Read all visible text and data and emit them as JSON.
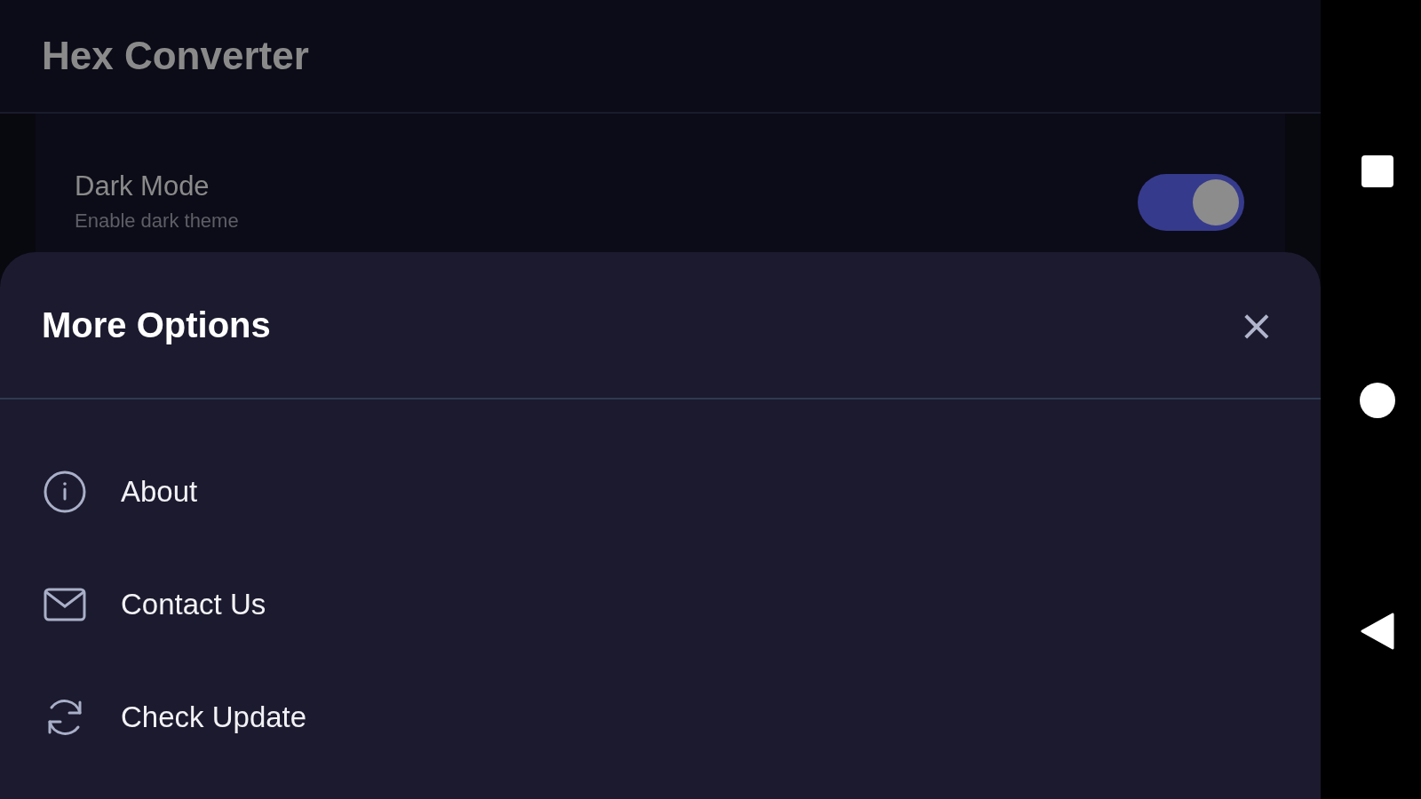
{
  "app_bar": {
    "title": "Hex Converter"
  },
  "settings": [
    {
      "label": "Dark Mode",
      "description": "Enable dark theme",
      "on": true
    }
  ],
  "sheet": {
    "title": "More Options",
    "close": "×",
    "items": [
      {
        "label": "About",
        "kind": "info"
      },
      {
        "label": "Contact Us",
        "kind": "mail"
      },
      {
        "label": "Check Update",
        "kind": "refresh"
      }
    ]
  }
}
